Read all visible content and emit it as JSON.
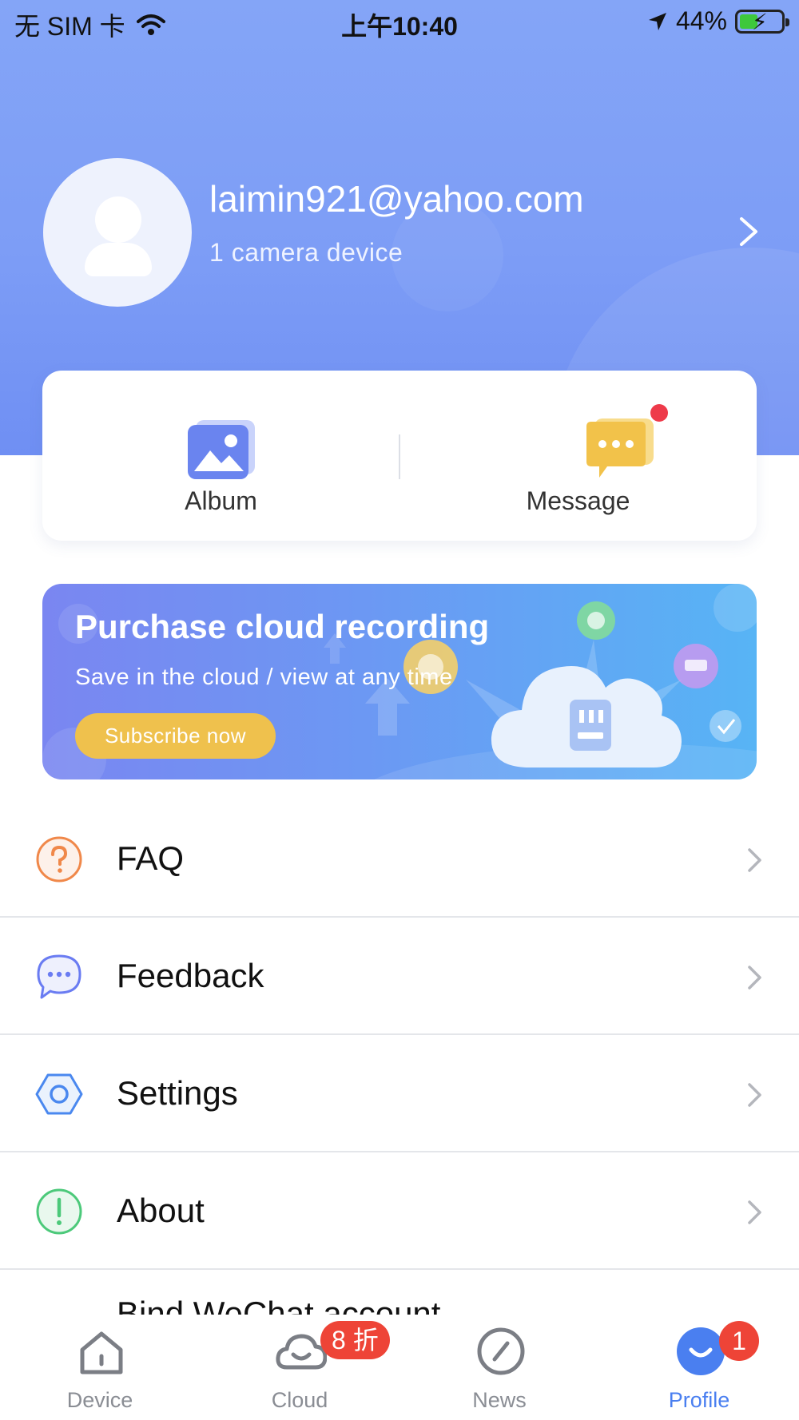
{
  "status_bar": {
    "carrier": "无 SIM 卡",
    "time": "上午10:40",
    "battery_percent": "44%"
  },
  "profile": {
    "email": "laimin921@yahoo.com",
    "device_count": "1 camera device"
  },
  "quick_actions": {
    "album_label": "Album",
    "message_label": "Message",
    "message_has_unread": true
  },
  "promo": {
    "title": "Purchase cloud recording",
    "subtitle": "Save in the cloud / view at any time",
    "button_label": "Subscribe now"
  },
  "menu": {
    "items": [
      {
        "label": "FAQ",
        "icon": "question-circle-icon",
        "color": "#f0884a"
      },
      {
        "label": "Feedback",
        "icon": "chat-bubble-icon",
        "color": "#6a7cf2"
      },
      {
        "label": "Settings",
        "icon": "hexagon-settings-icon",
        "color": "#4a88ef"
      },
      {
        "label": "About",
        "icon": "exclamation-circle-icon",
        "color": "#4cc97a"
      }
    ],
    "partial_item_label": "Bind WeChat account"
  },
  "tab_bar": {
    "tabs": [
      {
        "label": "Device",
        "icon": "house-icon",
        "active": false
      },
      {
        "label": "Cloud",
        "icon": "cloud-icon",
        "active": false
      },
      {
        "label": "News",
        "icon": "compass-icon",
        "active": false
      },
      {
        "label": "Profile",
        "icon": "smile-face-icon",
        "active": true
      }
    ],
    "cloud_badge": "8 折",
    "profile_badge": "1"
  },
  "colors": {
    "header_gradient_top": "#84a5f7",
    "accent_blue": "#4a7ff0",
    "promo_button": "#efc14d",
    "badge_red": "#ee4437"
  }
}
